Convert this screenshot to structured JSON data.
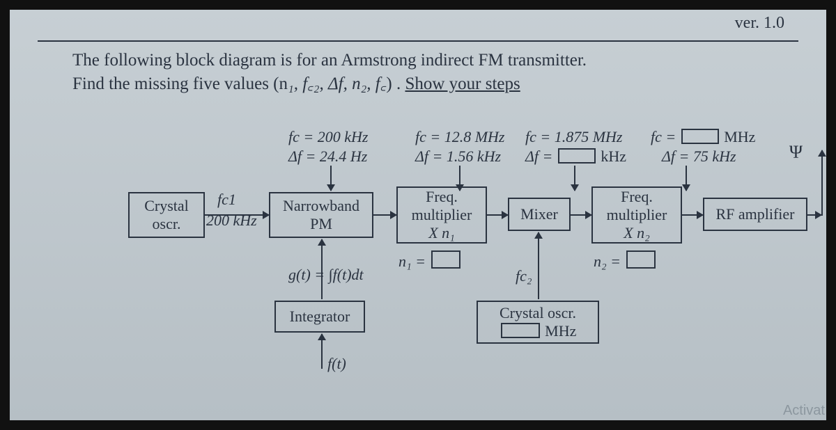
{
  "version": "ver. 1.0",
  "question": {
    "line1": "The following block diagram is for an Armstrong indirect FM transmitter.",
    "line2_prefix": "Find the missing five values  (n",
    "vars": "₁, f꜀₂, Δf, n₂, f꜀",
    "line2_suffix": ") . ",
    "show": "Show your steps"
  },
  "stages": {
    "s1": {
      "fc": "fc = 200 kHz",
      "df": "Δf = 24.4 Hz"
    },
    "s2": {
      "fc": "fc = 12.8 MHz",
      "df": "Δf = 1.56 kHz"
    },
    "s3": {
      "fc": "fc = 1.875 MHz",
      "df_pre": "Δf = ",
      "df_unit": "kHz"
    },
    "s4": {
      "fc_pre": "fc = ",
      "fc_unit": "MHz",
      "df": "Δf = 75 kHz"
    }
  },
  "blocks": {
    "xtal1_a": "Crystal",
    "xtal1_b": "oscr.",
    "fc1": "fc1",
    "fc1_val": "200 kHz",
    "nbpm_a": "Narrowband",
    "nbpm_b": "PM",
    "mult1_a": "Freq.",
    "mult1_b": "multiplier",
    "mult1_c": "X n₁",
    "mixer": "Mixer",
    "mult2_a": "Freq.",
    "mult2_b": "multiplier",
    "mult2_c": "X n₂",
    "rfamp": "RF amplifier",
    "integ": "Integrator",
    "xtal2_a": "Crystal oscr.",
    "xtal2_unit": "MHz",
    "n1lab": "n₁ =",
    "n2lab": "n₂ =",
    "gexpr": "g(t) = ∫f(t)dt",
    "ft": "f(t)",
    "fc2": "fc₂"
  },
  "watermark": "Activat"
}
